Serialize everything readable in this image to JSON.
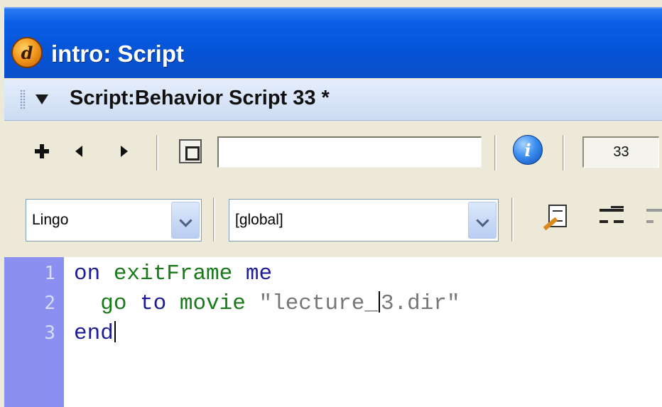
{
  "window": {
    "title": "intro: Script",
    "logo_glyph": "d"
  },
  "panel": {
    "title": "Script:Behavior Script 33 *"
  },
  "toolbar": {
    "member_name_value": "",
    "cast_member_number": "33",
    "icons": [
      "plus-icon",
      "back-icon",
      "forward-icon",
      "member-icon",
      "info-icon"
    ]
  },
  "selectors": {
    "language": "Lingo",
    "handler_scope": "[global]"
  },
  "editor": {
    "line_numbers": [
      "1",
      "2",
      "3"
    ],
    "lines": [
      {
        "kw1": "on",
        "fn": "exitFrame",
        "kw2": "me"
      },
      {
        "fn1": "go",
        "kw": "to",
        "fn2": "movie",
        "str_before_caret": "\"lecture_",
        "str_after_caret": "3.dir\""
      },
      {
        "kw": "end"
      }
    ],
    "colors": {
      "keyword": "#1d1d9a",
      "function": "#197a19",
      "string": "#777777",
      "gutter": "#8a8ff0"
    }
  }
}
